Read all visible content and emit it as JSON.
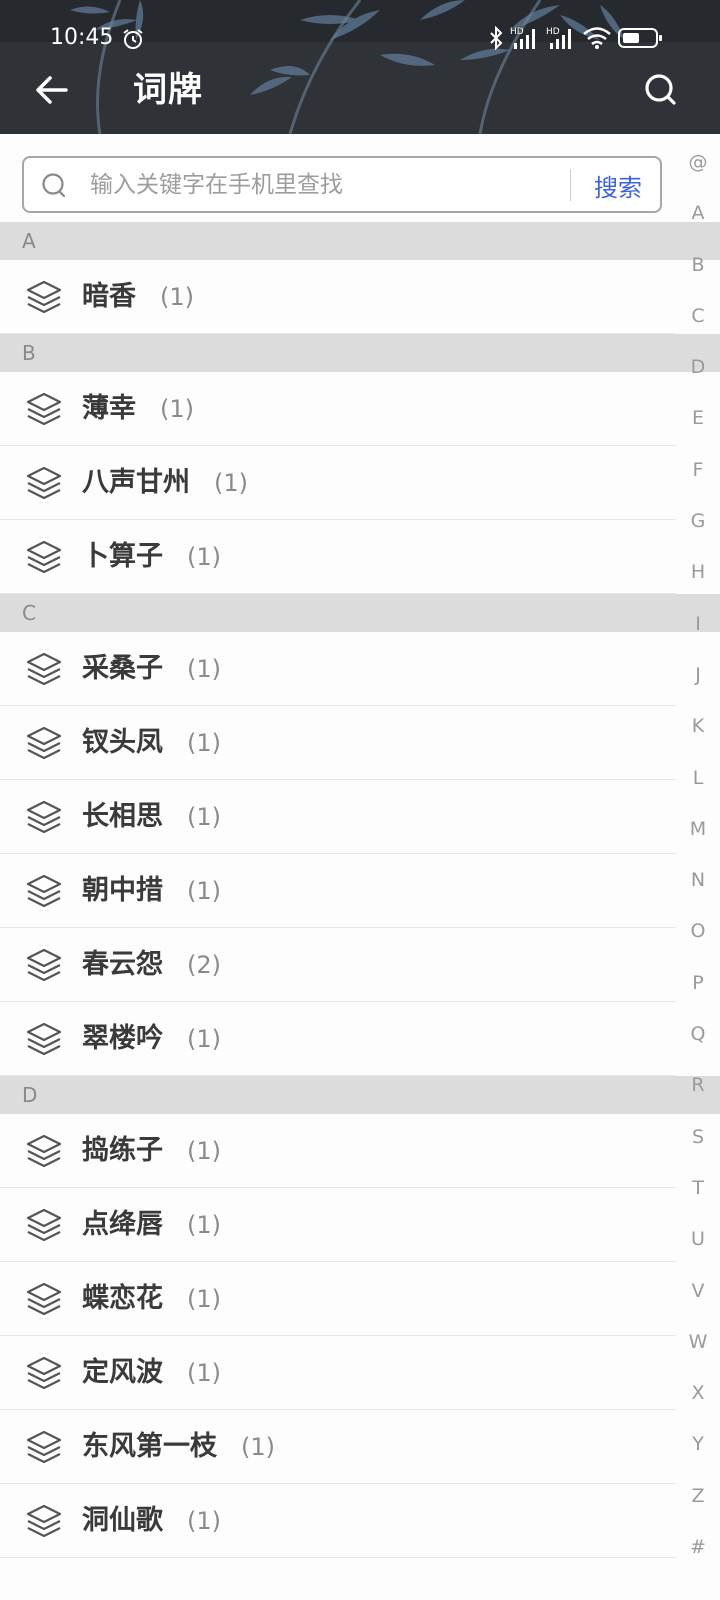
{
  "status_bar": {
    "time": "10:45",
    "alarm_icon": "alarm-clock-icon",
    "bluetooth_icon": "bluetooth-icon",
    "signal1_label": "HD",
    "signal2_label": "HD",
    "wifi_icon": "wifi-icon",
    "battery_icon": "battery-icon"
  },
  "header": {
    "title": "词牌",
    "back_icon": "back-arrow-icon",
    "search_icon": "search-icon"
  },
  "search": {
    "placeholder": "输入关键字在手机里查找",
    "value": "",
    "button_label": "搜索"
  },
  "sections": [
    {
      "letter": "A",
      "items": [
        {
          "name": "暗香",
          "count": "(1)"
        }
      ]
    },
    {
      "letter": "B",
      "items": [
        {
          "name": "薄幸",
          "count": "(1)"
        },
        {
          "name": "八声甘州",
          "count": "(1)"
        },
        {
          "name": "卜算子",
          "count": "(1)"
        }
      ]
    },
    {
      "letter": "C",
      "items": [
        {
          "name": "采桑子",
          "count": "(1)"
        },
        {
          "name": "钗头凤",
          "count": "(1)"
        },
        {
          "name": "长相思",
          "count": "(1)"
        },
        {
          "name": "朝中措",
          "count": "(1)"
        },
        {
          "name": "春云怨",
          "count": "(2)"
        },
        {
          "name": "翠楼吟",
          "count": "(1)"
        }
      ]
    },
    {
      "letter": "D",
      "items": [
        {
          "name": "捣练子",
          "count": "(1)"
        },
        {
          "name": "点绛唇",
          "count": "(1)"
        },
        {
          "name": "蝶恋花",
          "count": "(1)"
        },
        {
          "name": "定风波",
          "count": "(1)"
        },
        {
          "name": "东风第一枝",
          "count": "(1)"
        },
        {
          "name": "洞仙歌",
          "count": "(1)"
        }
      ]
    }
  ],
  "alphabet_index": [
    "@",
    "A",
    "B",
    "C",
    "D",
    "E",
    "F",
    "G",
    "H",
    "I",
    "J",
    "K",
    "L",
    "M",
    "N",
    "O",
    "P",
    "Q",
    "R",
    "S",
    "T",
    "U",
    "V",
    "W",
    "X",
    "Y",
    "Z",
    "#"
  ],
  "colors": {
    "header_bg": "#2f3236",
    "accent": "#3e63d6",
    "section_bg": "#dcdcdd"
  }
}
